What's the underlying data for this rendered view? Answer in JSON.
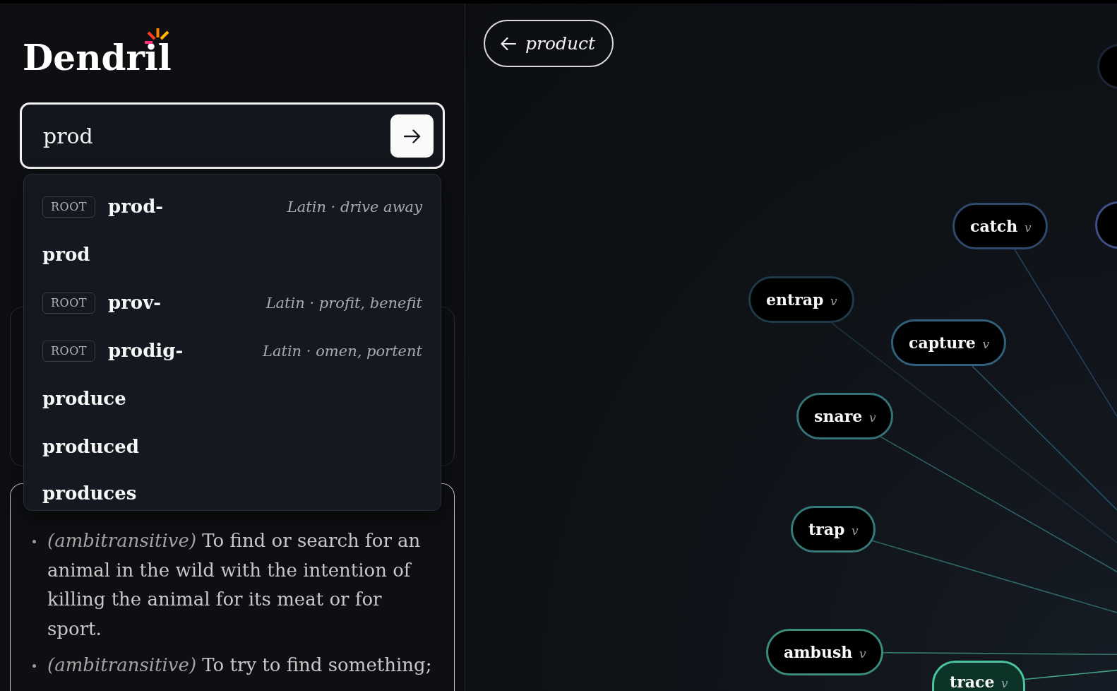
{
  "logo": {
    "text": "Dendril"
  },
  "search": {
    "value": "prod"
  },
  "suggestions": [
    {
      "kind": "root",
      "badge": "ROOT",
      "word": "prod-",
      "gloss": "Latin · drive away"
    },
    {
      "kind": "word",
      "word": "prod"
    },
    {
      "kind": "root",
      "badge": "ROOT",
      "word": "prov-",
      "gloss": "Latin · profit, benefit"
    },
    {
      "kind": "root",
      "badge": "ROOT",
      "word": "prodig-",
      "gloss": "Latin · omen, portent"
    },
    {
      "kind": "word",
      "word": "produce"
    },
    {
      "kind": "word",
      "word": "produced"
    },
    {
      "kind": "word",
      "word": "produces"
    }
  ],
  "definition_card": {
    "senses": [
      {
        "text": "*(ambitransitive)* To find or search for an animal in the wild with the intention of killing the animal for its meat or for sport."
      },
      {
        "text": "*(ambitransitive)* To try to find something;"
      }
    ]
  },
  "back_button": {
    "label": "product"
  },
  "graph": {
    "nodes": [
      {
        "color": "#1b2535",
        "selected": false
      },
      {
        "label": "catch",
        "pos": "v",
        "color": "#2d4a6c",
        "selected": false
      },
      {
        "color": "#3d4f86",
        "selected": false
      },
      {
        "label": "entrap",
        "pos": "v",
        "color": "#1f3a48",
        "selected": false
      },
      {
        "label": "capture",
        "pos": "v",
        "color": "#30607c",
        "selected": false
      },
      {
        "label": "snare",
        "pos": "v",
        "color": "#357278",
        "selected": false
      },
      {
        "label": "trap",
        "pos": "v",
        "color": "#347a78",
        "selected": false
      },
      {
        "label": "ambush",
        "pos": "v",
        "color": "#3c8c7a",
        "selected": false
      },
      {
        "label": "trace",
        "pos": "v",
        "color": "#4cc29f",
        "selected": true
      }
    ]
  }
}
